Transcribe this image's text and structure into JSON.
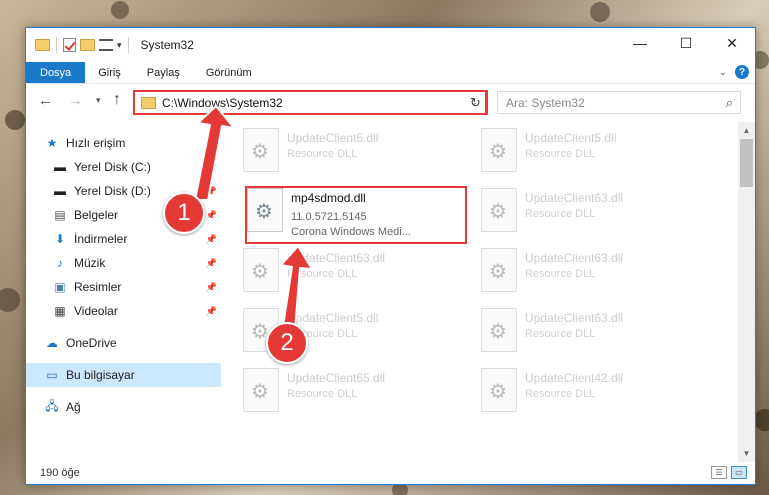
{
  "window": {
    "title": "System32"
  },
  "ribbon": {
    "tabs": [
      "Dosya",
      "Giriş",
      "Paylaş",
      "Görünüm"
    ]
  },
  "address": {
    "path": "C:\\Windows\\System32"
  },
  "search": {
    "placeholder": "Ara: System32"
  },
  "nav": {
    "quick_access": "Hızlı erişim",
    "items": [
      {
        "label": "Yerel Disk (C:)",
        "icon": "drive-icon"
      },
      {
        "label": "Yerel Disk (D:)",
        "icon": "drive-icon"
      },
      {
        "label": "Belgeler",
        "icon": "documents-icon"
      },
      {
        "label": "İndirmeler",
        "icon": "download-icon"
      },
      {
        "label": "Müzik",
        "icon": "music-icon"
      },
      {
        "label": "Resimler",
        "icon": "pictures-icon"
      },
      {
        "label": "Videolar",
        "icon": "video-icon"
      }
    ],
    "onedrive": "OneDrive",
    "this_pc": "Bu bilgisayar",
    "network": "Ağ"
  },
  "files": [
    {
      "name": "UpdateClient5.dll",
      "desc": "Resource DLL"
    },
    {
      "name": "UpdateClient5.dll",
      "desc": "Resource DLL"
    },
    {
      "name": "mp4sdmod.dll",
      "desc": "11.0.5721.5145",
      "desc2": "Corona Windows Medi..."
    },
    {
      "name": "UpdateClient63.dll",
      "desc": "Resource DLL"
    },
    {
      "name": "UpdateClient63.dll",
      "desc": "Resource DLL"
    },
    {
      "name": "UpdateClient63.dll",
      "desc": "Resource DLL"
    },
    {
      "name": "UpdateClient5.dll",
      "desc": "Resource DLL"
    },
    {
      "name": "UpdateClient63.dll",
      "desc": "Resource DLL"
    },
    {
      "name": "UpdateClient65.dll",
      "desc": "Resource DLL"
    },
    {
      "name": "UpdateClient42.dll",
      "desc": "Resource DLL"
    }
  ],
  "status": {
    "count": "190 öğe"
  },
  "annotations": {
    "step1": "1",
    "step2": "2"
  },
  "colors": {
    "accent": "#1979ca",
    "highlight": "#e53935"
  }
}
